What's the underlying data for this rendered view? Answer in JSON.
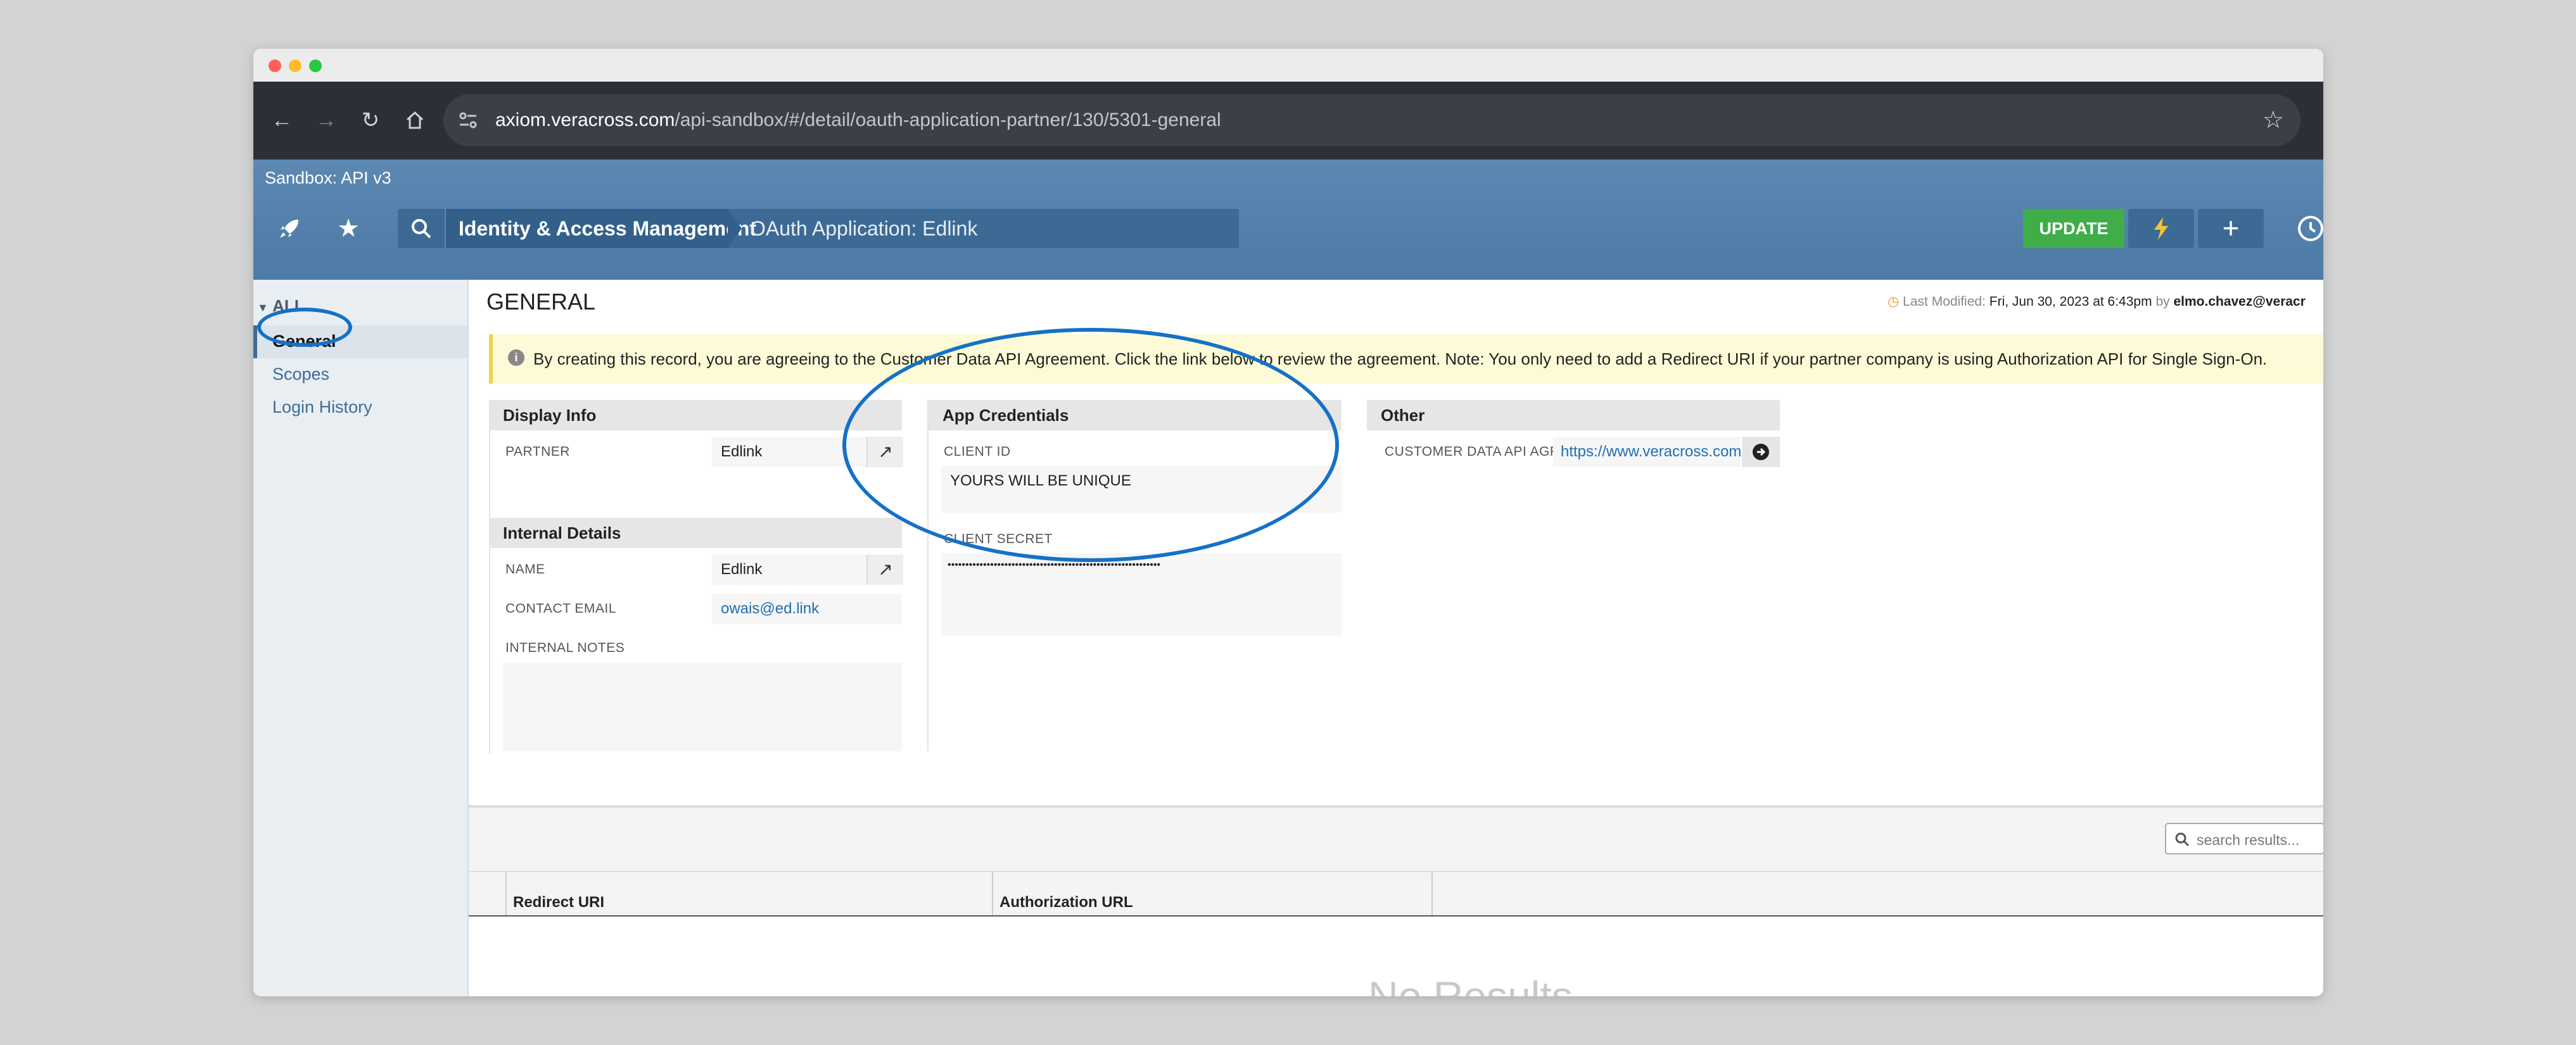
{
  "browser": {
    "url_host": "axiom.veracross.com",
    "url_path": "/api-sandbox/#/detail/oauth-application-partner/130/5301-general"
  },
  "app": {
    "sandbox_label": "Sandbox: API v3",
    "breadcrumb_section": "Identity & Access Management",
    "breadcrumb_page": "OAuth Application: Edlink",
    "update_label": "UPDATE"
  },
  "sidebar": {
    "all_label": "ALL",
    "items": [
      {
        "label": "General"
      },
      {
        "label": "Scopes"
      },
      {
        "label": "Login History"
      }
    ]
  },
  "main": {
    "title": "GENERAL",
    "last_modified_label": "Last Modified:",
    "last_modified_date": "Fri, Jun 30, 2023 at 6:43pm",
    "by_label": "by",
    "modified_by": "elmo.chavez@veracr",
    "notice": "By creating this record, you are agreeing to the Customer Data API Agreement. Click the link below to review the agreement. Note: You only need to add a Redirect URI if your partner company is using Authorization API for Single Sign-On.",
    "display_info": {
      "title": "Display Info",
      "partner_label": "PARTNER",
      "partner_value": "Edlink"
    },
    "internal_details": {
      "title": "Internal Details",
      "name_label": "NAME",
      "name_value": "Edlink",
      "contact_email_label": "CONTACT EMAIL",
      "contact_email_value": "owais@ed.link",
      "internal_notes_label": "INTERNAL NOTES"
    },
    "app_credentials": {
      "title": "App Credentials",
      "client_id_label": "CLIENT ID",
      "client_id_value": "YOURS WILL BE UNIQUE",
      "client_secret_label": "CLIENT SECRET",
      "client_secret_value": "••••••••••••••••••••••••••••••••••••••••••••••••••••••••••••"
    },
    "other": {
      "title": "Other",
      "agreement_label": "CUSTOMER DATA API AGR...",
      "agreement_value": "https://www.veracross.com"
    },
    "table": {
      "search_placeholder": "search results...",
      "columns": [
        "Redirect URI",
        "Authorization URL"
      ],
      "empty_message": "No Results"
    }
  },
  "colors": {
    "header_blue": "#4d7aa6",
    "update_green": "#3fae49",
    "annotation_blue": "#1571c6",
    "notice_yellow": "#fdfbd7"
  }
}
